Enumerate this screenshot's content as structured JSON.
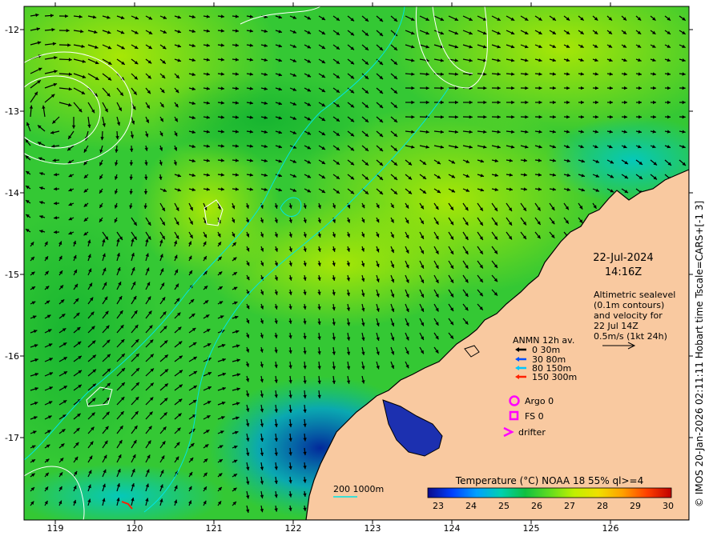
{
  "map": {
    "lon_range": [
      118.6,
      126.95
    ],
    "lat_range": [
      -17.98,
      -11.7
    ],
    "lon_ticks": [
      "119",
      "120",
      "121",
      "122",
      "123",
      "124",
      "125",
      "126"
    ],
    "lat_ticks": [
      "-12",
      "-13",
      "-14",
      "-15",
      "-16",
      "-17"
    ],
    "date": "22-Jul-2024",
    "time": "14:16Z",
    "description_lines": [
      "Altimetric sealevel",
      "(0.1m contours)",
      "and velocity for",
      "22 Jul 14Z",
      "0.5m/s (1kt 24h)"
    ],
    "copyright": "© IMOS 20-Jan-2026 02:11:11 Hobart time Tscale=CARS+[-1 3]",
    "colors": {
      "land": "#f9c9a0",
      "sst_warm": "#9ee000",
      "sst_cool": "#1fbf3a",
      "arrow": "#000000",
      "contour": "#ffffff",
      "isobath": "#00e5e5"
    }
  },
  "legend": {
    "anmn_title": "ANMN 12h av.",
    "depths": [
      {
        "label": "0 30m",
        "color": "#000000"
      },
      {
        "label": "30 80m",
        "color": "#0050ff"
      },
      {
        "label": "80 150m",
        "color": "#00c8ff"
      },
      {
        "label": "150 300m",
        "color": "#ff2000"
      }
    ],
    "argo": "Argo 0",
    "fs": "FS 0",
    "drifter": "drifter",
    "marker_color": "#ff00ff",
    "isobath_label": "200  1000m"
  },
  "colorbar": {
    "title": "Temperature (°C) NOAA 18 55% ql>=4",
    "ticks": [
      "23",
      "24",
      "25",
      "26",
      "27",
      "28",
      "29",
      "30"
    ],
    "colors": [
      "#0a0a8c",
      "#0040ff",
      "#00a0ff",
      "#00d0b0",
      "#10c040",
      "#60dc20",
      "#c0f000",
      "#f0e000",
      "#ffa000",
      "#ff4000",
      "#c00000"
    ]
  }
}
